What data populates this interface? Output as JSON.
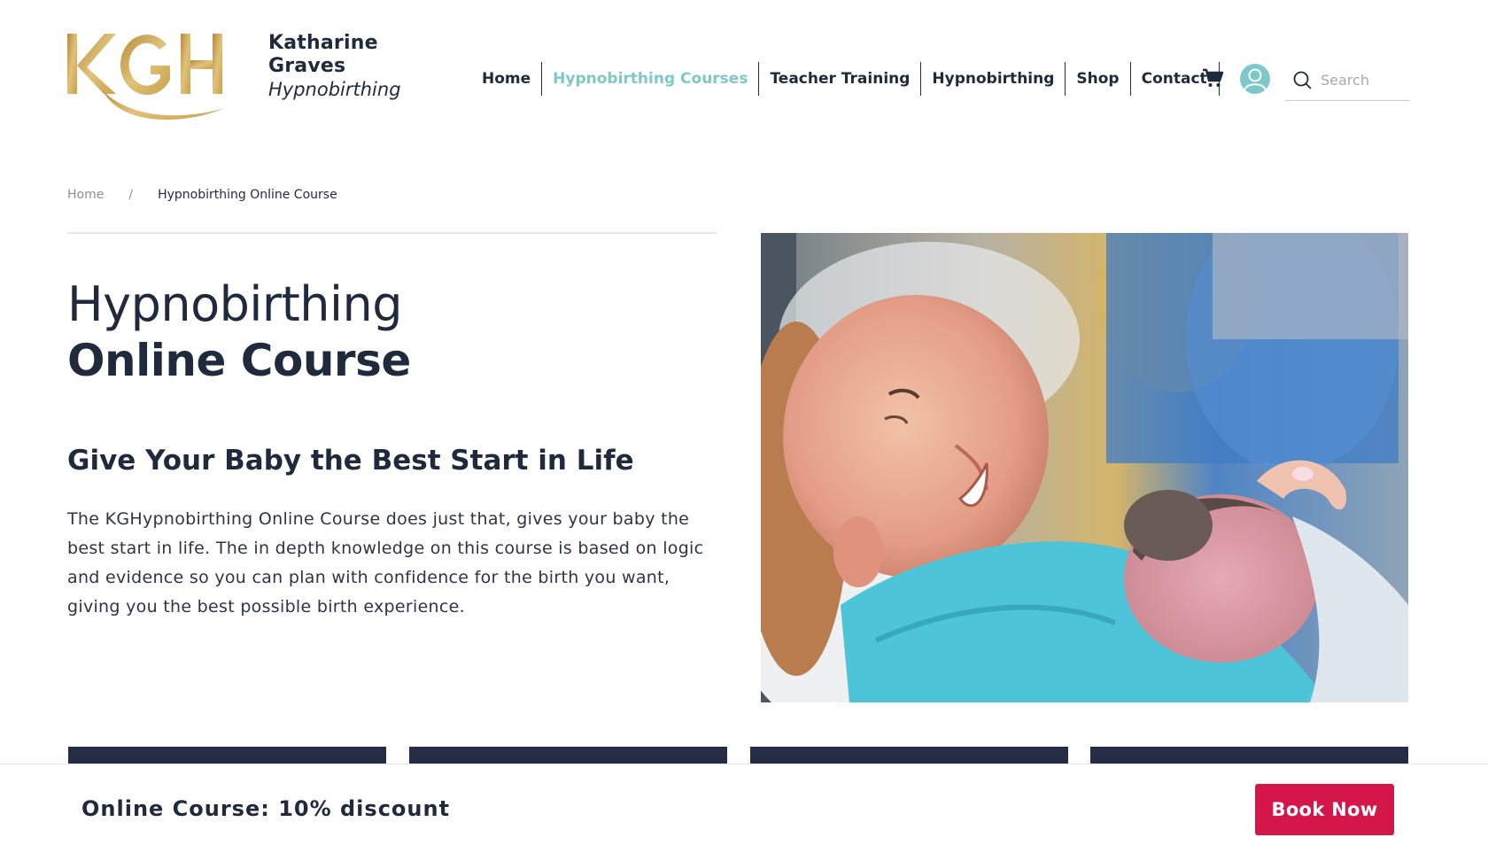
{
  "header": {
    "logo": {
      "mark_letters": "KGH",
      "name_line1": "Katharine",
      "name_line2": "Graves",
      "name_line3": "Hypnobirthing",
      "gold": "#c9a14a"
    },
    "nav": [
      {
        "label": "Home",
        "active": false
      },
      {
        "label": "Hypnobirthing Courses",
        "active": true
      },
      {
        "label": "Teacher Training",
        "active": false
      },
      {
        "label": "Hypnobirthing",
        "active": false
      },
      {
        "label": "Shop",
        "active": false
      },
      {
        "label": "Contact",
        "active": false
      }
    ],
    "icons": {
      "cart": "cart-icon",
      "user": "user-icon",
      "search": "search-icon"
    },
    "search_placeholder": "Search",
    "accent": "#7ec8c9"
  },
  "breadcrumb": {
    "home": "Home",
    "separator": "/",
    "current": "Hypnobirthing Online Course"
  },
  "main": {
    "title_line1": "Hypnobirthing",
    "title_line2": "Online Course",
    "subtitle": "Give Your Baby the Best Start in Life",
    "body": "The KGHypnobirthing Online Course does just that, gives your baby the best start in life. The in depth knowledge on this course is based on logic and evidence so you can plan with confidence for the birth you want, giving you the best possible birth experience."
  },
  "sticky_bar": {
    "offer_text": "Online Course: 10% discount",
    "cta_label": "Book Now",
    "cta_color": "#d4164a"
  },
  "colors": {
    "navy": "#1f2a3d",
    "card_navy": "#252d44"
  }
}
